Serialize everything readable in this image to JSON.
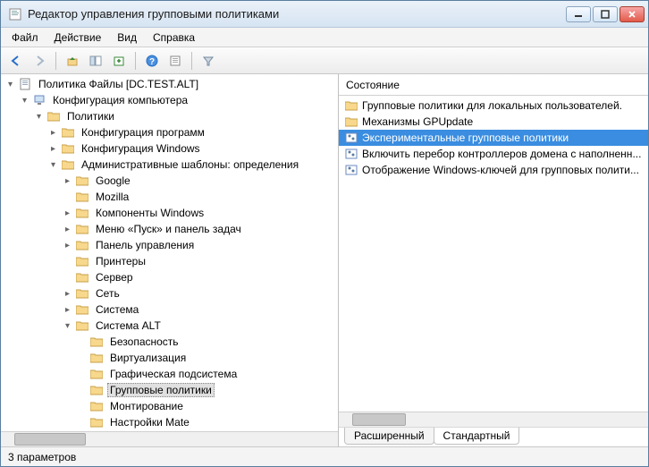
{
  "window": {
    "title": "Редактор управления групповыми политиками"
  },
  "menu": {
    "file": "Файл",
    "action": "Действие",
    "view": "Вид",
    "help": "Справка"
  },
  "tree": {
    "root": "Политика Файлы [DC.TEST.ALT]",
    "computer_config": "Конфигурация компьютера",
    "policies": "Политики",
    "config_programs": "Конфигурация программ",
    "config_windows": "Конфигурация Windows",
    "admin_templates": "Административные шаблоны: определения",
    "google": "Google",
    "mozilla": "Mozilla",
    "components_windows": "Компоненты Windows",
    "start_menu": "Меню «Пуск» и панель задач",
    "control_panel": "Панель управления",
    "printers": "Принтеры",
    "server": "Сервер",
    "network": "Сеть",
    "system": "Система",
    "system_alt": "Система ALT",
    "security": "Безопасность",
    "virtualization": "Виртуализация",
    "graphics_subsys": "Графическая подсистема",
    "group_policies": "Групповые политики",
    "mounting": "Монтирование",
    "mate_settings": "Настройки Mate"
  },
  "right": {
    "header": "Состояние",
    "items": {
      "0": "Групповые политики для локальных пользователей.",
      "1": "Механизмы GPUpdate",
      "2": "Экспериментальные групповые политики",
      "3": "Включить перебор контроллеров домена с наполненн...",
      "4": "Отображение Windows-ключей для групповых полити..."
    }
  },
  "tabs": {
    "extended": "Расширенный",
    "standard": "Стандартный"
  },
  "status": {
    "text": "3 параметров"
  }
}
